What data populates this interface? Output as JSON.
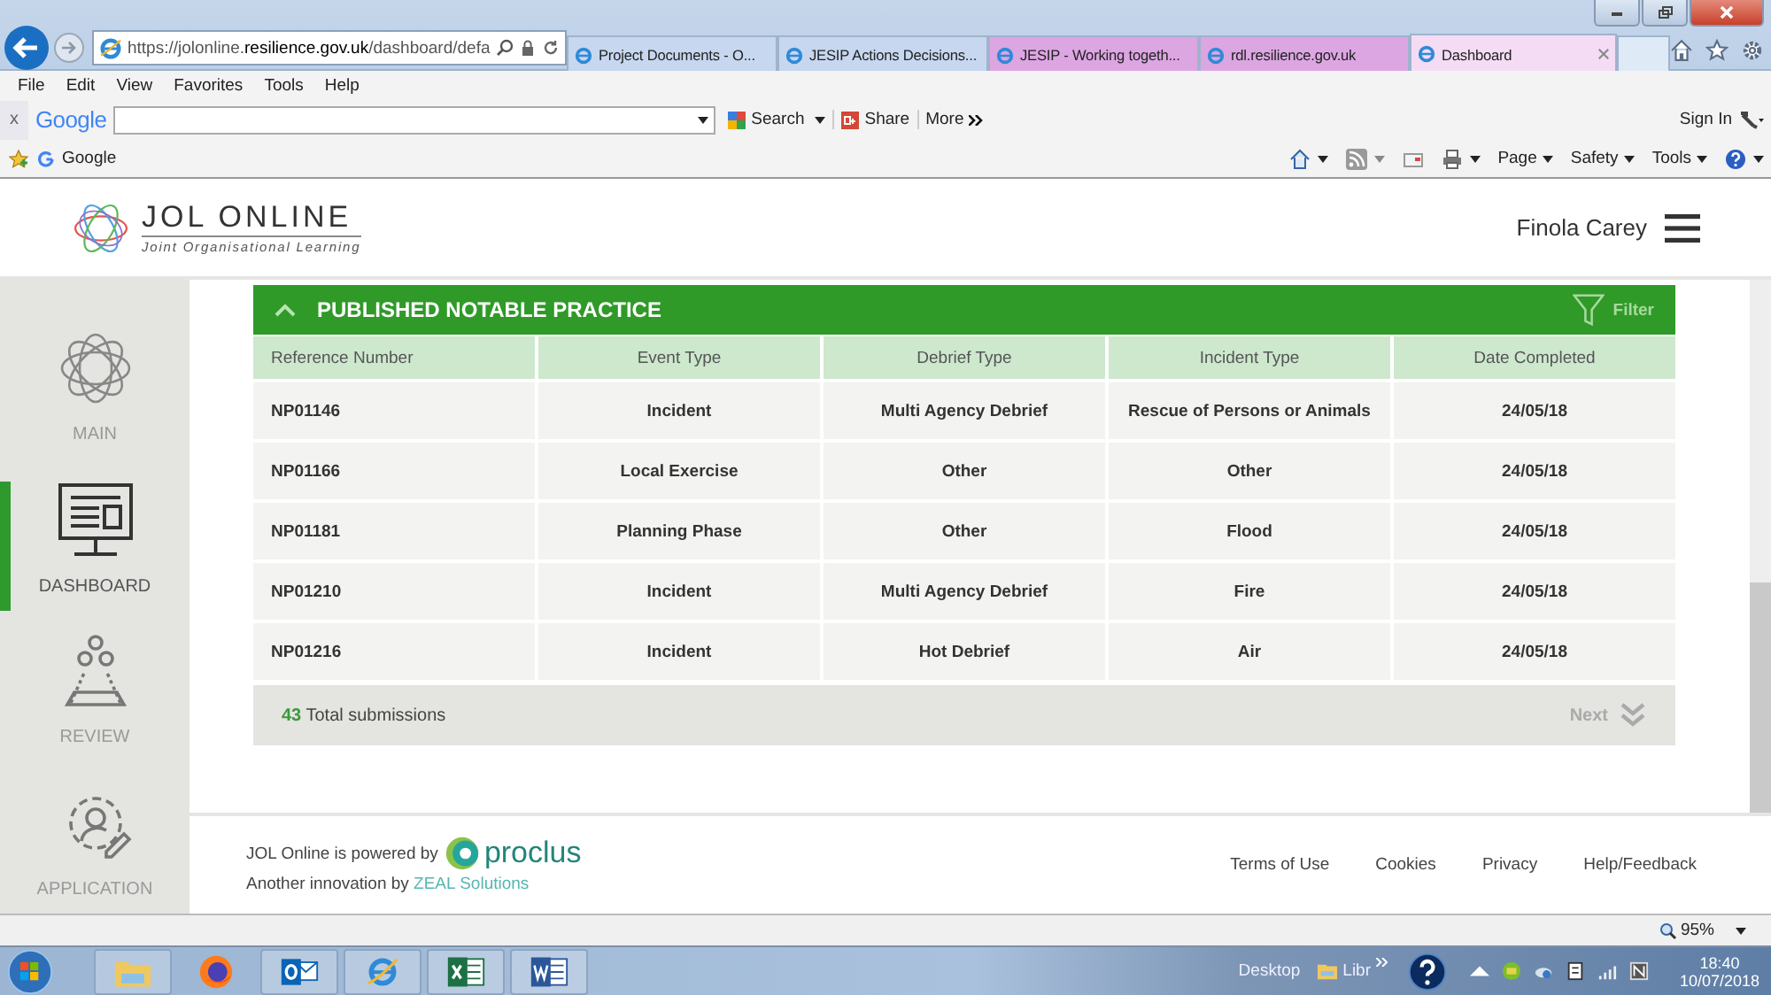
{
  "browser": {
    "url_host_prefix": "https://jolonline.",
    "url_domain": "resilience.gov.uk",
    "url_path": "/dashboard/defa",
    "tabs": [
      {
        "title": "Project Documents - O...",
        "selected": false,
        "color": "#c6d7ef"
      },
      {
        "title": "JESIP Actions Decisions...",
        "selected": false,
        "color": "#c6d7ef"
      },
      {
        "title": "JESIP - Working togeth...",
        "selected": false,
        "color": "#dca6e2"
      },
      {
        "title": "rdl.resilience.gov.uk",
        "selected": false,
        "color": "#dca6e2"
      },
      {
        "title": "Dashboard",
        "selected": true,
        "color": "#f4dcf5"
      }
    ],
    "menu": [
      "File",
      "Edit",
      "View",
      "Favorites",
      "Tools",
      "Help"
    ],
    "toolbar": {
      "close": "x",
      "brand": "Google",
      "search": "Search",
      "share": "Share",
      "more": "More",
      "sign_in": "Sign In"
    },
    "favorites": [
      "Google"
    ],
    "commands": [
      "Page",
      "Safety",
      "Tools"
    ]
  },
  "site": {
    "logo_title": "JOL ONLINE",
    "logo_subtitle": "Joint Organisational Learning",
    "user": "Finola Carey",
    "sidebar": [
      {
        "label": "MAIN",
        "selected": false
      },
      {
        "label": "DASHBOARD",
        "selected": true
      },
      {
        "label": "REVIEW",
        "selected": false
      },
      {
        "label": "APPLICATION",
        "selected": false
      }
    ],
    "panel": {
      "title": "PUBLISHED NOTABLE PRACTICE",
      "expanded": true,
      "filter": "Filter",
      "columns": [
        "Reference Number",
        "Event Type",
        "Debrief Type",
        "Incident Type",
        "Date Completed"
      ],
      "rows": [
        [
          "NP01146",
          "Incident",
          "Multi Agency Debrief",
          "Rescue of Persons or Animals",
          "24/05/18"
        ],
        [
          "NP01166",
          "Local Exercise",
          "Other",
          "Other",
          "24/05/18"
        ],
        [
          "NP01181",
          "Planning Phase",
          "Other",
          "Flood",
          "24/05/18"
        ],
        [
          "NP01210",
          "Incident",
          "Multi Agency Debrief",
          "Fire",
          "24/05/18"
        ],
        [
          "NP01216",
          "Incident",
          "Hot Debrief",
          "Air",
          "24/05/18"
        ]
      ],
      "count": "43",
      "count_label": "Total submissions",
      "next": {
        "label": "Next",
        "disabled": true
      }
    },
    "footer": {
      "powered": "JOL Online is powered by",
      "brand": "proclus",
      "innovation": "Another innovation by",
      "company": "ZEAL Solutions",
      "links": [
        "Terms of Use",
        "Cookies",
        "Privacy",
        "Help/Feedback"
      ]
    }
  },
  "status_bar": {
    "zoom": "95%"
  },
  "taskbar": {
    "desktop": "Desktop",
    "library": "Libr",
    "time": "18:40",
    "date": "10/07/2018"
  }
}
